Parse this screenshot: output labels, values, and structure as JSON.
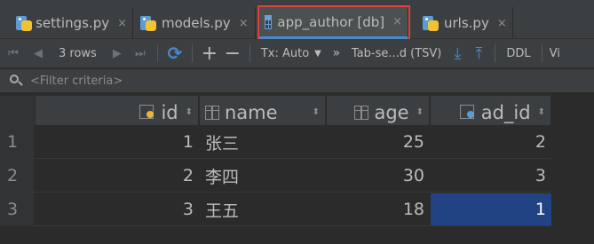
{
  "tabs": [
    {
      "label": "settings.py",
      "icon": "python-file-icon",
      "close": "×"
    },
    {
      "label": "models.py",
      "icon": "python-file-icon",
      "close": "×"
    },
    {
      "label": "app_author [db]",
      "icon": "table-icon",
      "close": "×"
    },
    {
      "label": "urls.py",
      "icon": "python-file-icon",
      "close": "×"
    }
  ],
  "toolbar": {
    "first": "⏮",
    "prev": "◀",
    "rows_label": "3 rows",
    "next": "▶",
    "last": "⏭",
    "refresh": "⟳",
    "add": "+",
    "remove": "−",
    "tx_label": "Tx: Auto",
    "tx_dropdown": "▼",
    "more": "»",
    "export_format": "Tab-se...d (TSV)",
    "download": "⤓",
    "upload": "⤒",
    "ddl": "DDL",
    "view": "Vi"
  },
  "filter": {
    "placeholder": "<Filter criteria>"
  },
  "columns": [
    {
      "name": "id",
      "icon": "primary-key-icon"
    },
    {
      "name": "name",
      "icon": "column-icon"
    },
    {
      "name": "age",
      "icon": "column-icon"
    },
    {
      "name": "ad_id",
      "icon": "foreign-key-icon"
    }
  ],
  "sort_glyph": "⬍",
  "rows": [
    {
      "num": "1",
      "id": "1",
      "name": "张三",
      "age": "25",
      "ad_id": "2"
    },
    {
      "num": "2",
      "id": "2",
      "name": "李四",
      "age": "30",
      "ad_id": "3"
    },
    {
      "num": "3",
      "id": "3",
      "name": "王五",
      "age": "18",
      "ad_id": "1"
    }
  ],
  "selected_cell": {
    "row": 3,
    "column": "ad_id"
  },
  "colors": {
    "accent": "#4a88c7",
    "selection": "#214283",
    "highlight_box": "#e0413c"
  }
}
